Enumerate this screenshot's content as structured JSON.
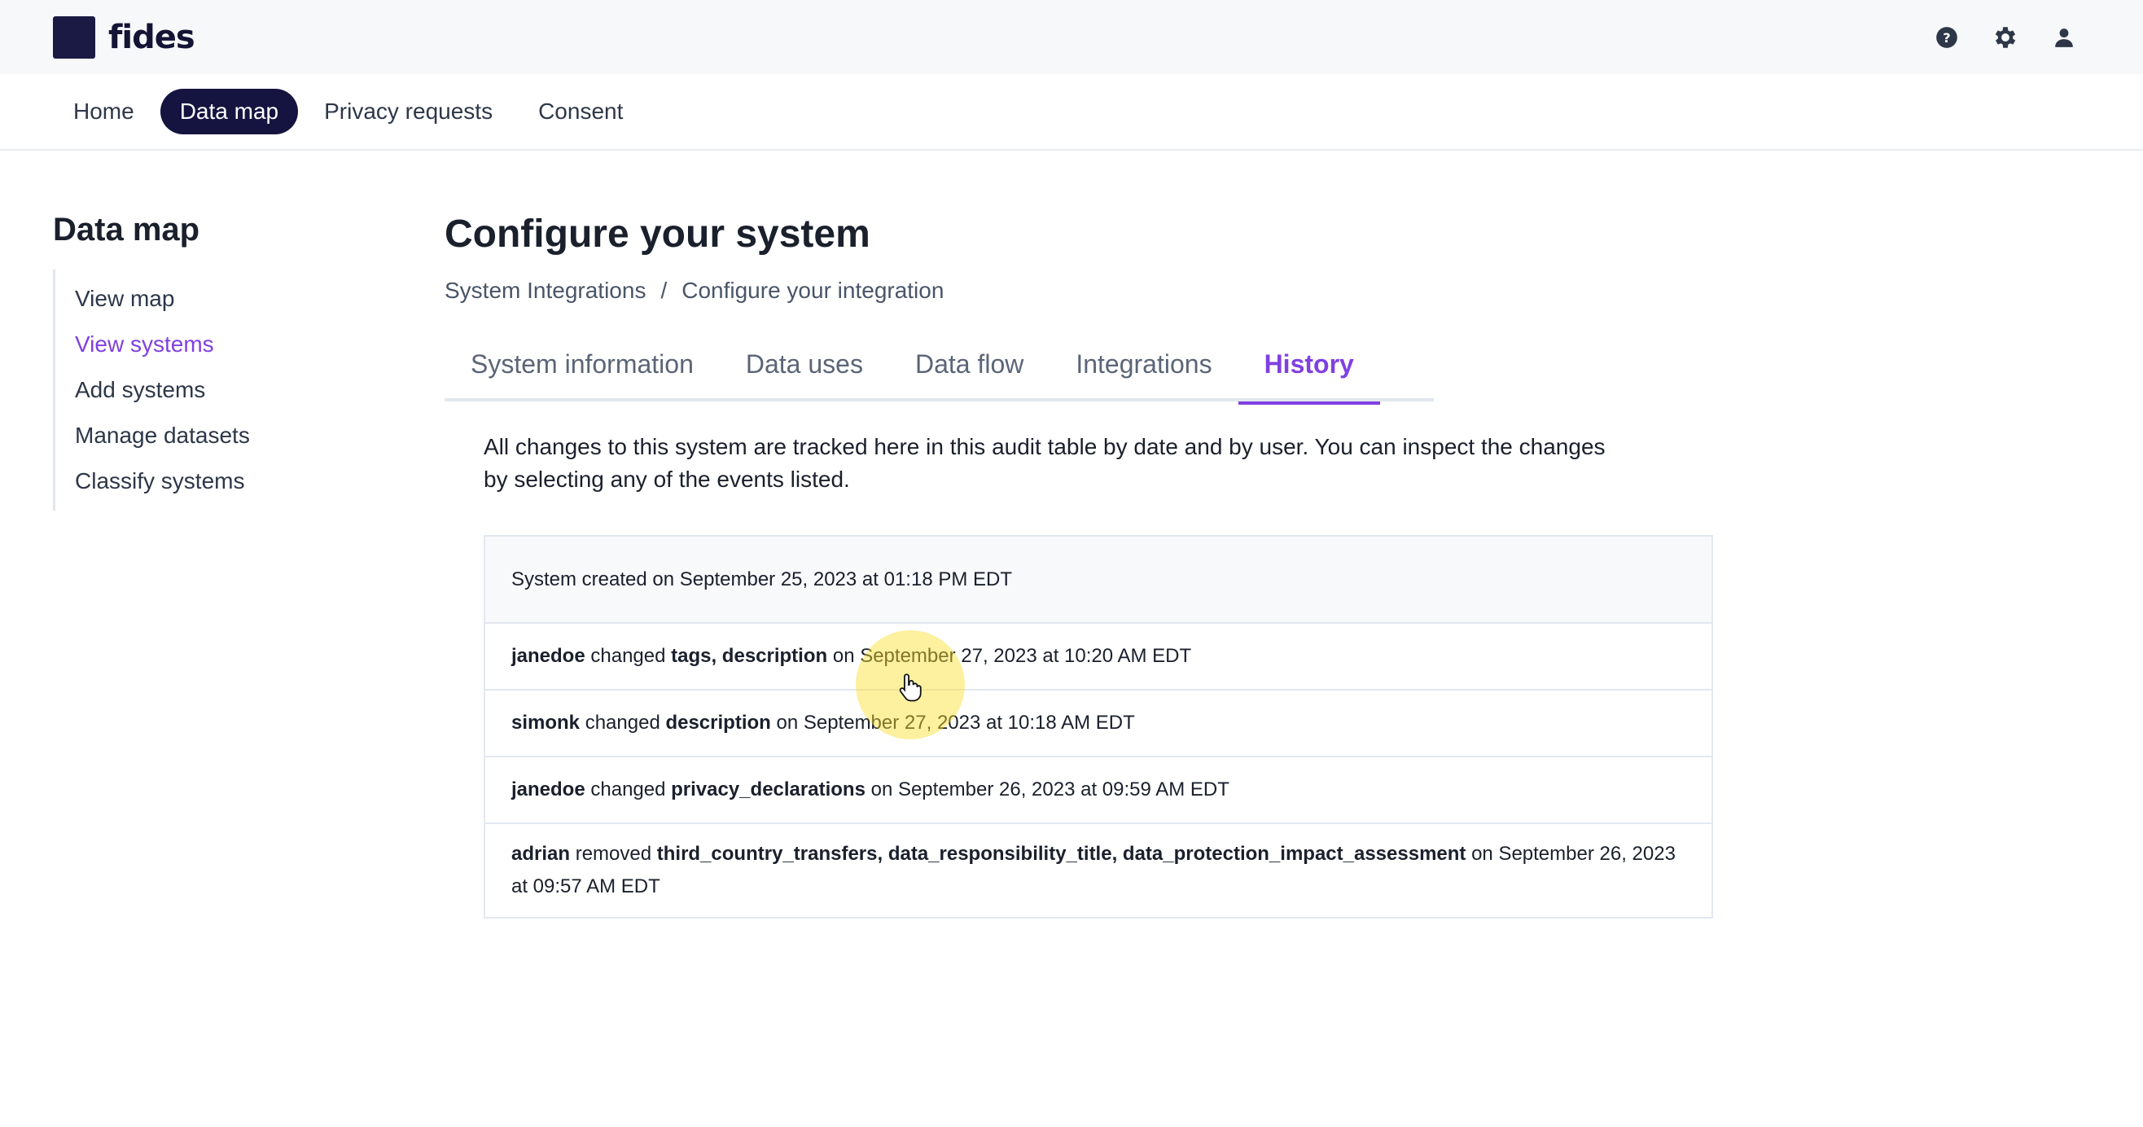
{
  "app": {
    "name": "fides"
  },
  "colors": {
    "brand": "#151440",
    "accent": "#8040e0"
  },
  "header": {
    "icons": [
      "help-icon",
      "settings-gear-icon",
      "user-account-icon"
    ]
  },
  "nav": {
    "items": [
      {
        "label": "Home"
      },
      {
        "label": "Data map"
      },
      {
        "label": "Privacy requests"
      },
      {
        "label": "Consent"
      }
    ],
    "active": "Data map"
  },
  "sidebar": {
    "title": "Data map",
    "items": [
      {
        "label": "View map"
      },
      {
        "label": "View systems"
      },
      {
        "label": "Add systems"
      },
      {
        "label": "Manage datasets"
      },
      {
        "label": "Classify systems"
      }
    ],
    "active": "View systems"
  },
  "main": {
    "title": "Configure your system",
    "breadcrumb": {
      "parent": "System Integrations",
      "separator": "/",
      "current": "Configure your integration"
    },
    "tabs": [
      {
        "label": "System information"
      },
      {
        "label": "Data uses"
      },
      {
        "label": "Data flow"
      },
      {
        "label": "Integrations"
      },
      {
        "label": "History"
      }
    ],
    "active_tab": "History",
    "intro": "All changes to this system are tracked here in this audit table by date and by user. You can inspect the changes by selecting any of the events listed."
  },
  "history": {
    "created": "System created on September 25, 2023 at 01:18 PM EDT",
    "events": [
      {
        "user": "janedoe",
        "action": " changed ",
        "fields": "tags, description",
        "when": " on September 27, 2023 at 10:20 AM EDT"
      },
      {
        "user": "simonk",
        "action": " changed ",
        "fields": "description",
        "when": " on September 27, 2023 at 10:18 AM EDT"
      },
      {
        "user": "janedoe",
        "action": " changed ",
        "fields": "privacy_declarations",
        "when": " on September 26, 2023 at 09:59 AM EDT"
      },
      {
        "user": "adrian",
        "action": " removed ",
        "fields": "third_country_transfers, data_responsibility_title, data_protection_impact_assessment",
        "when": " on September 26, 2023 at 09:57 AM EDT"
      }
    ]
  }
}
